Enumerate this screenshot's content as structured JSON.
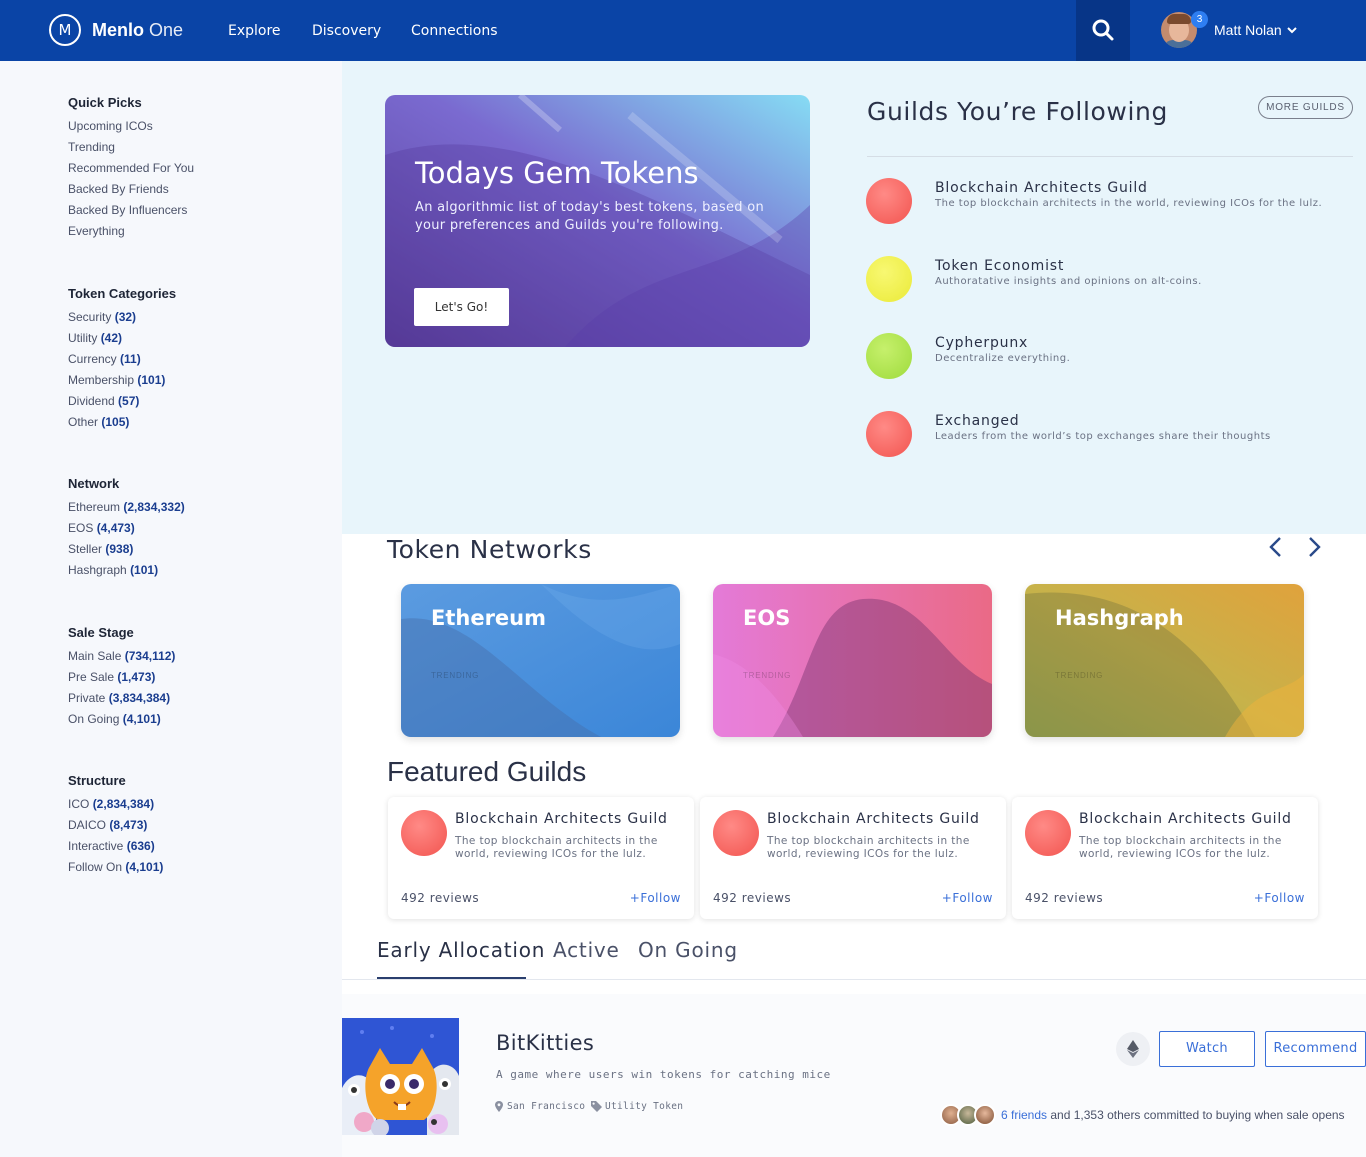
{
  "header": {
    "brand_bold": "Menlo",
    "brand_light": "One",
    "logo_letter": "M",
    "nav": [
      "Explore",
      "Discovery",
      "Connections"
    ],
    "notification_count": "3",
    "user_name": "Matt Nolan"
  },
  "sidebar": {
    "quick_picks": {
      "title": "Quick Picks",
      "items": [
        "Upcoming ICOs",
        "Trending",
        "Recommended For You",
        "Backed By Friends",
        "Backed By Influencers",
        "Everything"
      ]
    },
    "token_categories": {
      "title": "Token Categories",
      "items": [
        {
          "label": "Security",
          "count": "(32)"
        },
        {
          "label": "Utility",
          "count": "(42)"
        },
        {
          "label": "Currency",
          "count": "(11)"
        },
        {
          "label": "Membership",
          "count": "(101)"
        },
        {
          "label": "Dividend",
          "count": "(57)"
        },
        {
          "label": "Other",
          "count": "(105)"
        }
      ]
    },
    "network": {
      "title": "Network",
      "items": [
        {
          "label": "Ethereum",
          "count": "(2,834,332)"
        },
        {
          "label": "EOS",
          "count": "(4,473)"
        },
        {
          "label": "Steller",
          "count": "(938)"
        },
        {
          "label": "Hashgraph",
          "count": "(101)"
        }
      ]
    },
    "sale_stage": {
      "title": "Sale Stage",
      "items": [
        {
          "label": "Main Sale",
          "count": "(734,112)"
        },
        {
          "label": "Pre Sale",
          "count": "(1,473)"
        },
        {
          "label": "Private",
          "count": "(3,834,384)"
        },
        {
          "label": "On Going",
          "count": "(4,101)"
        }
      ]
    },
    "structure": {
      "title": "Structure",
      "items": [
        {
          "label": "ICO",
          "count": "(2,834,384)"
        },
        {
          "label": "DAICO",
          "count": "(8,473)"
        },
        {
          "label": "Interactive",
          "count": "(636)"
        },
        {
          "label": "Follow On",
          "count": "(4,101)"
        }
      ]
    }
  },
  "gem": {
    "title": "Todays Gem Tokens",
    "subtitle": "An algorithmic list of today's best tokens, based on your preferences and Guilds you're following.",
    "button": "Let's Go!"
  },
  "following": {
    "title": "Guilds You’re Following",
    "more": "MORE GUILDS",
    "guilds": [
      {
        "name": "Blockchain Architects Guild",
        "desc": "The top blockchain architects in the world, reviewing ICOs for the lulz.",
        "color": "#f2544f"
      },
      {
        "name": "Token Economist",
        "desc": "Authoratative insights and opinions on alt-coins.",
        "color": "#eef03e"
      },
      {
        "name": "Cypherpunx",
        "desc": "Decentralize everything.",
        "color": "#a8e243"
      },
      {
        "name": "Exchanged",
        "desc": "Leaders from the world’s top exchanges share their thoughts",
        "color": "#f2544f"
      }
    ]
  },
  "networks": {
    "title": "Token Networks",
    "cards": [
      {
        "name": "Ethereum",
        "tag": "TRENDING"
      },
      {
        "name": "EOS",
        "tag": "TRENDING"
      },
      {
        "name": "Hashgraph",
        "tag": "TRENDING"
      }
    ]
  },
  "featured": {
    "title": "Featured Guilds",
    "cards": [
      {
        "name": "Blockchain Architects Guild",
        "desc": "The top blockchain architects in the world, reviewing ICOs for the lulz.",
        "reviews": "492 reviews",
        "follow": "+Follow"
      },
      {
        "name": "Blockchain Architects Guild",
        "desc": "The top blockchain architects in the world, reviewing ICOs for the lulz.",
        "reviews": "492 reviews",
        "follow": "+Follow"
      },
      {
        "name": "Blockchain Architects Guild",
        "desc": "The top blockchain architects in the world, reviewing ICOs for the lulz.",
        "reviews": "492 reviews",
        "follow": "+Follow"
      }
    ]
  },
  "tabs": [
    "Early Allocation",
    "Active",
    "On Going"
  ],
  "listing": {
    "name": "BitKitties",
    "desc": "A game where users win tokens for catching mice",
    "location": "San Francisco",
    "token_type": "Utility Token",
    "watch": "Watch",
    "recommend": "Recommend",
    "friends_link": "6 friends",
    "commit_text": " and 1,353 others committed to buying when sale opens"
  },
  "colors": {
    "header_bg": "#0a44a6",
    "accent": "#3a6fd8",
    "hero_bg": "#e8f5fb"
  }
}
